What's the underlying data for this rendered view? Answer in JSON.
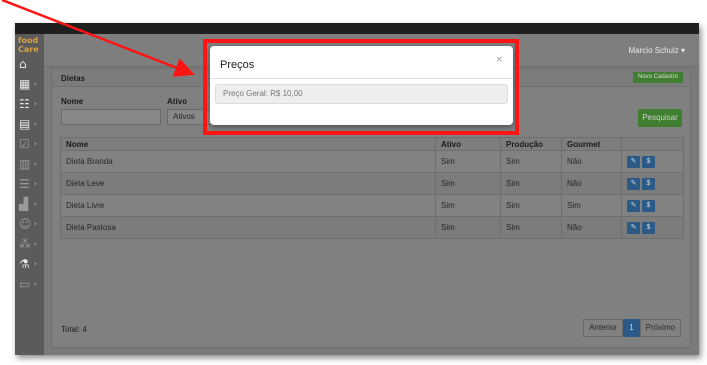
{
  "app": {
    "logo_text": "food\nCare",
    "user_menu": "Marcio Schulz ▾"
  },
  "rail": {
    "icons": [
      "home-icon",
      "grid-icon",
      "people-icon",
      "notebook-icon",
      "checklist-icon",
      "report-icon",
      "list-icon",
      "buildings-icon",
      "team-icon",
      "dropper-icon",
      "flask-icon",
      "monitor-icon"
    ]
  },
  "page": {
    "title": "Dietas",
    "new_button": "Novo Cadastro",
    "filters": {
      "name_label": "Nome",
      "name_value": "",
      "active_label": "Ativo",
      "active_value": "Ativos"
    },
    "search_button": "Pesquisar"
  },
  "table": {
    "headers": [
      "Nome",
      "Ativo",
      "Produção",
      "Gourmet",
      ""
    ],
    "rows": [
      {
        "nome": "Dieta Branda",
        "ativo": "Sim",
        "producao": "Sim",
        "gourmet": "Não"
      },
      {
        "nome": "Dieta Leve",
        "ativo": "Sim",
        "producao": "Sim",
        "gourmet": "Não"
      },
      {
        "nome": "Dieta Livre",
        "ativo": "Sim",
        "producao": "Sim",
        "gourmet": "Sim"
      },
      {
        "nome": "Dieta Pastosa",
        "ativo": "Sim",
        "producao": "Sim",
        "gourmet": "Não"
      }
    ],
    "edit_icon": "✎",
    "price_icon": "$"
  },
  "footer": {
    "total": "Total: 4",
    "pager": {
      "prev": "Anterior",
      "page": "1",
      "next": "Próximo"
    }
  },
  "modal": {
    "title": "Preços",
    "close": "×",
    "item": "Preço Geral: R$ 10,00"
  },
  "colors": {
    "highlight": "#ff1414",
    "accent_green": "#3f7f2f",
    "accent_blue": "#2a5a85"
  }
}
